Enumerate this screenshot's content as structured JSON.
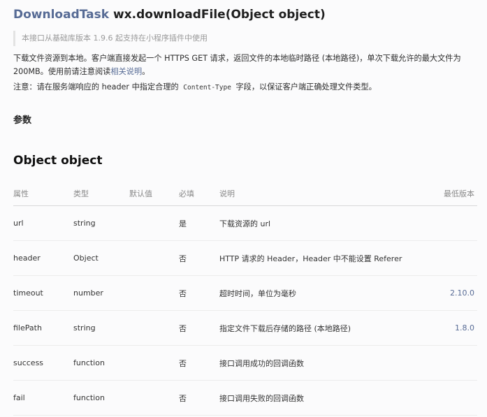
{
  "heading": {
    "class_link": "DownloadTask",
    "signature": " wx.downloadFile(Object object)"
  },
  "note": "本接口从基础库版本 1.9.6 起支持在小程序插件中使用",
  "description": {
    "text": "下载文件资源到本地。客户端直接发起一个 HTTPS GET 请求，返回文件的本地临时路径 (本地路径)，单次下载允许的最大文件为 200MB。使用前请注意阅读",
    "link": "相关说明",
    "end": "。"
  },
  "notice": {
    "prefix": "注意：请在服务端响应的 header 中指定合理的 ",
    "code": "Content-Type",
    "suffix": " 字段，以保证客户端正确处理文件类型。"
  },
  "params_heading": "参数",
  "object_heading": "Object object",
  "table": {
    "headers": [
      "属性",
      "类型",
      "默认值",
      "必填",
      "说明",
      "最低版本"
    ],
    "rows": [
      [
        "url",
        "string",
        "",
        "是",
        "下载资源的 url",
        ""
      ],
      [
        "header",
        "Object",
        "",
        "否",
        "HTTP 请求的 Header，Header 中不能设置 Referer",
        ""
      ],
      [
        "timeout",
        "number",
        "",
        "否",
        "超时时间，单位为毫秒",
        "2.10.0"
      ],
      [
        "filePath",
        "string",
        "",
        "否",
        "指定文件下载后存储的路径 (本地路径)",
        "1.8.0"
      ],
      [
        "success",
        "function",
        "",
        "否",
        "接口调用成功的回调函数",
        ""
      ],
      [
        "fail",
        "function",
        "",
        "否",
        "接口调用失败的回调函数",
        ""
      ]
    ]
  },
  "colors": {
    "link": "#576b95",
    "text": "#2c2c2c",
    "muted": "#9a9a9a",
    "background": "#fbfbfc"
  }
}
